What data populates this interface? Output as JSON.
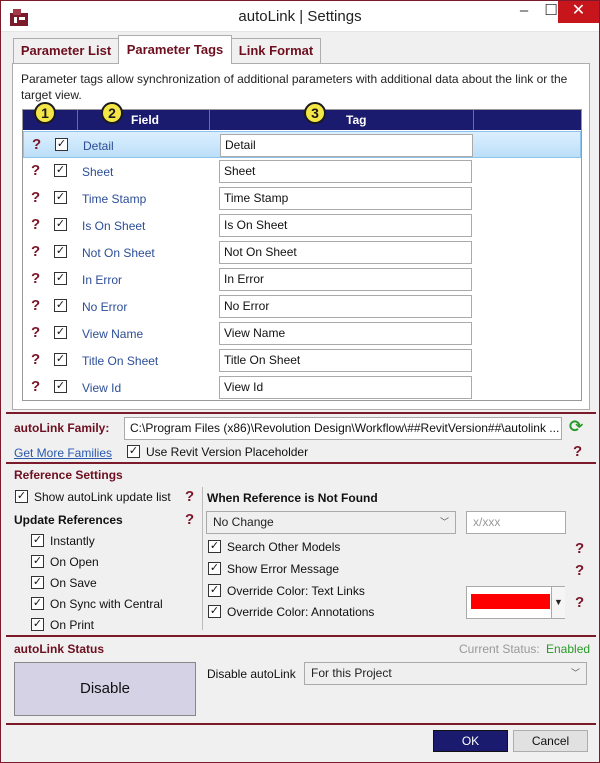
{
  "window": {
    "title": "autoLink | Settings",
    "min_glyph": "–",
    "max_glyph": "☐",
    "close_glyph": "✕"
  },
  "tabs": [
    {
      "label": "Parameter List"
    },
    {
      "label": "Parameter Tags",
      "active": true
    },
    {
      "label": "Link Format"
    }
  ],
  "parameter_tags": {
    "description": "Parameter tags allow synchronization of additional parameters with additional data about the link or the target view.",
    "badges": [
      "1",
      "2",
      "3"
    ],
    "columns": [
      "Field",
      "Tag"
    ],
    "rows": [
      {
        "field": "Detail",
        "tag": "Detail",
        "checked": true,
        "selected": true
      },
      {
        "field": "Sheet",
        "tag": "Sheet",
        "checked": true
      },
      {
        "field": "Time Stamp",
        "tag": "Time Stamp",
        "checked": true
      },
      {
        "field": "Is On Sheet",
        "tag": "Is On Sheet",
        "checked": true
      },
      {
        "field": "Not On Sheet",
        "tag": "Not On Sheet",
        "checked": true
      },
      {
        "field": "In Error",
        "tag": "In Error",
        "checked": true
      },
      {
        "field": "No Error",
        "tag": "No Error",
        "checked": true
      },
      {
        "field": "View Name",
        "tag": "View Name",
        "checked": true
      },
      {
        "field": "Title On Sheet",
        "tag": "Title On Sheet",
        "checked": true
      },
      {
        "field": "View Id",
        "tag": "View Id",
        "checked": true
      }
    ],
    "help_glyph": "?",
    "check_glyph": "✓"
  },
  "family": {
    "label": "autoLink Family:",
    "path": "C:\\Program Files (x86)\\Revolution Design\\Workflow\\##RevitVersion##\\autolink ...",
    "get_more": "Get More Families",
    "use_placeholder": "Use Revit Version Placeholder",
    "refresh_glyph": "⟳"
  },
  "reference_settings": {
    "title": "Reference Settings",
    "show_update_list": "Show autoLink update list",
    "update_references": "Update References",
    "update_options": [
      "Instantly",
      "On Open",
      "On Save",
      "On Sync with Central",
      "On Print"
    ],
    "not_found_title": "When Reference is Not Found",
    "not_found_selected": "No Change",
    "xxx_placeholder": "x/xxx",
    "not_found_options": [
      "Search Other Models",
      "Show Error Message",
      "Override Color: Text Links",
      "Override Color: Annotations"
    ],
    "override_color": "#ff0000"
  },
  "status": {
    "title": "autoLink Status",
    "current_label": "Current Status:",
    "current_value": "Enabled",
    "disable_button": "Disable",
    "disable_label": "Disable autoLink",
    "disable_selected": "For this Project"
  },
  "footer": {
    "ok": "OK",
    "cancel": "Cancel"
  }
}
